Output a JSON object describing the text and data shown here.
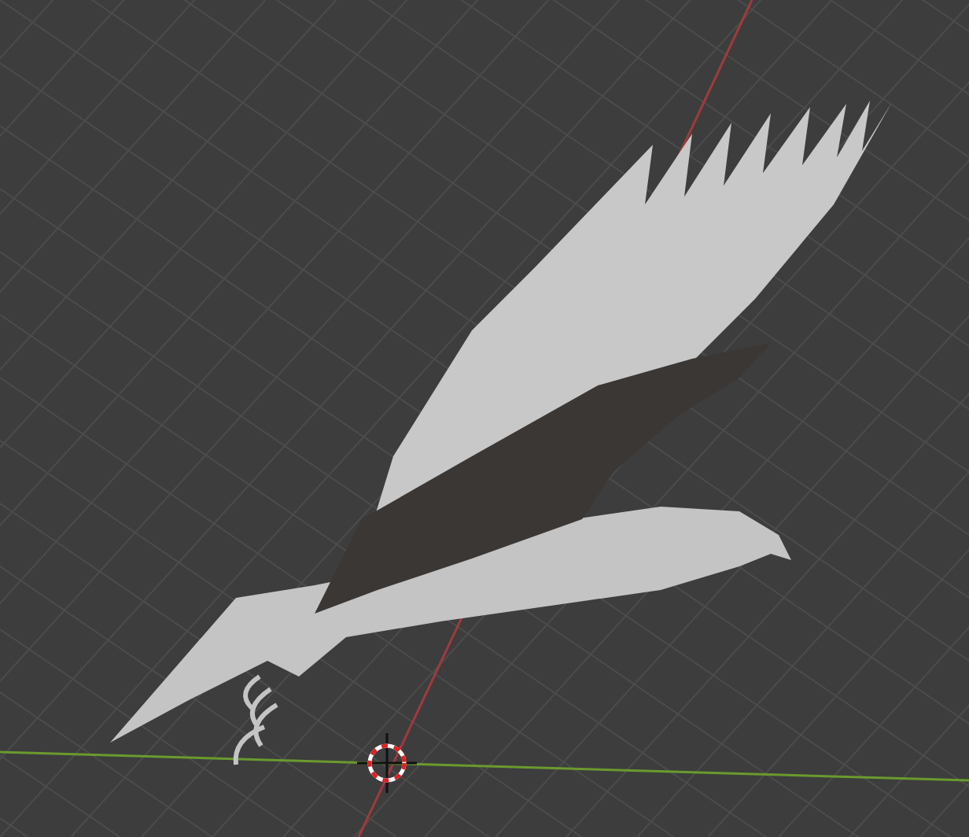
{
  "viewport": {
    "grid": true,
    "cursor": true
  }
}
